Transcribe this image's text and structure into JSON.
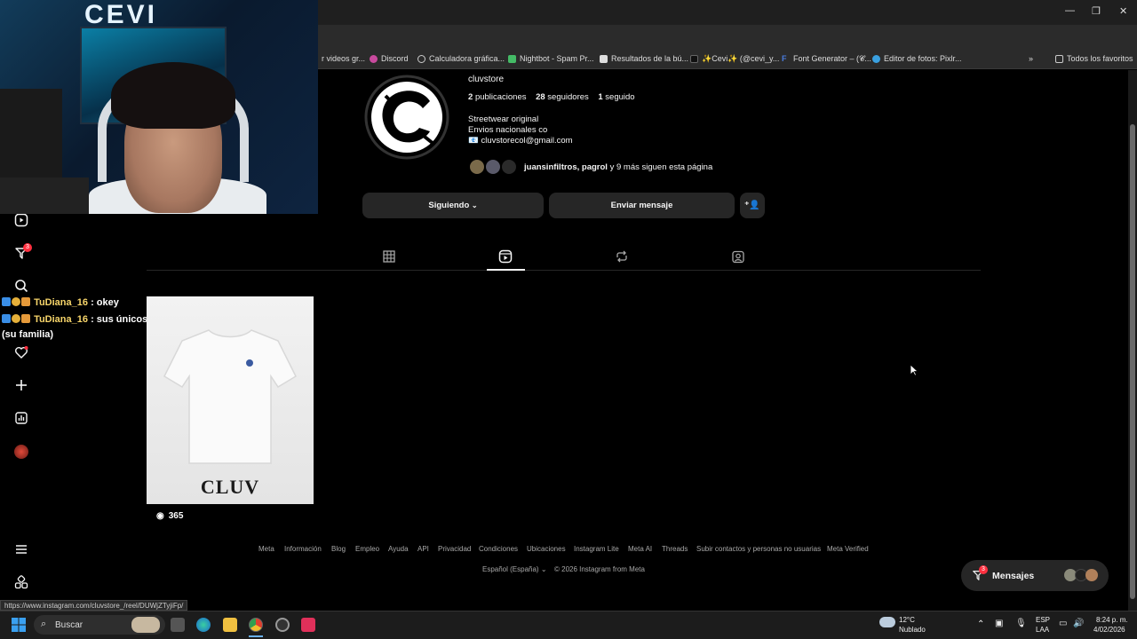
{
  "browser": {
    "bookmarks": [
      {
        "label": "r videos gr...",
        "icon": "bookmark-icon"
      },
      {
        "label": "Discord",
        "icon": "discord-icon"
      },
      {
        "label": "Calculadora gráfica...",
        "icon": "desmos-icon"
      },
      {
        "label": "Nightbot - Spam Pr...",
        "icon": "nightbot-icon"
      },
      {
        "label": "Resultados de la bú...",
        "icon": "doc-icon"
      },
      {
        "label": "✨Cevi✨ (@cevi_y...",
        "icon": "tiktok-icon"
      },
      {
        "label": "Font Generator – (𝓒...",
        "icon": "font-icon"
      },
      {
        "label": "Editor de fotos: Pixlr...",
        "icon": "pixlr-icon"
      }
    ],
    "all_bookmarks": "Todos los favoritos",
    "status_url": "https://www.instagram.com/cluvstore_/reel/DUWjZTyjiFp/"
  },
  "chat": [
    {
      "user": "TuDiana_16",
      "message": ": okey"
    },
    {
      "user": "TuDiana_16",
      "message": ": sus únicos clientes"
    }
  ],
  "chat_wrap": "(su familia)",
  "nav": {
    "notifications_badge": "3"
  },
  "profile": {
    "username": "cluvstore",
    "posts_count": "2",
    "posts_label": "publicaciones",
    "followers_count": "28",
    "followers_label": "seguidores",
    "following_count": "1",
    "following_label": "seguido",
    "bio_line1": "Streetwear original",
    "bio_line2": "Envios nacionales co",
    "bio_email": "📧 cluvstorecol@gmail.com",
    "followed_by_names": "juansinfiltros, pagrol",
    "followed_by_rest": " y 9 más siguen esta página"
  },
  "buttons": {
    "following": "Siguiendo",
    "message": "Enviar mensaje"
  },
  "reel": {
    "brand": "CLUV",
    "views": "365"
  },
  "footer": {
    "links": [
      "Meta",
      "Información",
      "Blog",
      "Empleo",
      "Ayuda",
      "API",
      "Privacidad",
      "Condiciones",
      "Ubicaciones",
      "Instagram Lite",
      "Meta AI",
      "Threads",
      "Subir contactos y personas no usuarias",
      "Meta Verified"
    ],
    "language": "Español (España)",
    "copyright": "© 2026 Instagram from Meta"
  },
  "messages": {
    "label": "Mensajes",
    "badge": "3"
  },
  "taskbar": {
    "search_placeholder": "Buscar",
    "weather_temp": "12°C",
    "weather_desc": "Nublado",
    "lang1": "ESP",
    "lang2": "LAA",
    "time": "8:24 p. m.",
    "date": "4/02/2026"
  }
}
